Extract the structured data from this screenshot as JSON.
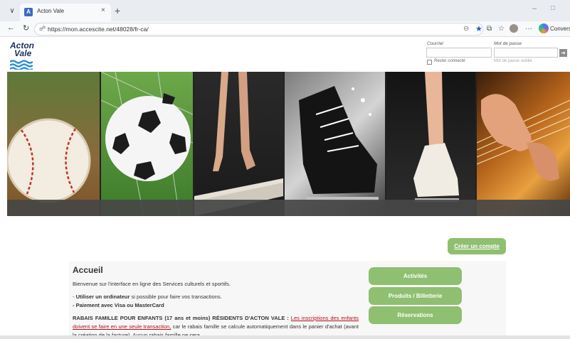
{
  "browser": {
    "tab_title": "Acton Vale",
    "tab_favicon": "page-favicon",
    "tab_close": "×",
    "new_tab": "+",
    "url": "https://mon.accescite.net/48028/fr-ca/",
    "copilot_label": "Conversati",
    "icons": [
      "chevron-down-icon",
      "back-icon",
      "reload-icon",
      "lock-icon",
      "zoom-icon",
      "favorite-star-icon",
      "extensions-icon",
      "collections-icon",
      "profile-avatar",
      "more-icon",
      "copilot-icon",
      "minimize-icon",
      "restore-icon"
    ]
  },
  "site": {
    "logo": {
      "line1": "Acton",
      "line2": "Vale",
      "icon": "waves-logo"
    },
    "login": {
      "email_label": "Courriel",
      "password_label": "Mot de passe",
      "remember_label": "Rester connecté",
      "forgot_label": "Mot de passe oublié",
      "submit_icon": "arrow-right-icon"
    },
    "banner": {
      "panels": [
        "baseball",
        "soccer-ball",
        "gymnast-balance-beam",
        "hockey-skate",
        "figure-skate",
        "guitar"
      ]
    },
    "create_account": "Créer un compte",
    "main": {
      "title": "Accueil",
      "intro": "Bienvenue sur l'interface en ligne des Services culturels et sportifs.",
      "bullet1_bold": "Utiliser un ordinateur",
      "bullet1_rest": " si possible pour faire vos transactions.",
      "bullet2": "- Paiement avec Visa ou MasterCard",
      "rabais_bold": "RABAIS FAMILLE POUR ENFANTS (17 ans et moins) RÉSIDENTS D'ACTON VALE : ",
      "rabais_red": "Les inscriptions des enfants doivent se faire en une seule transaction,",
      "rabais_rest": " car le rabais famille se calcule automatiquement dans le panier d'achat (avant la création de la facture). Aucun rabais famille ne sera"
    },
    "side_buttons": [
      "Activités",
      "Produits / Billetterie",
      "Réservations"
    ]
  }
}
